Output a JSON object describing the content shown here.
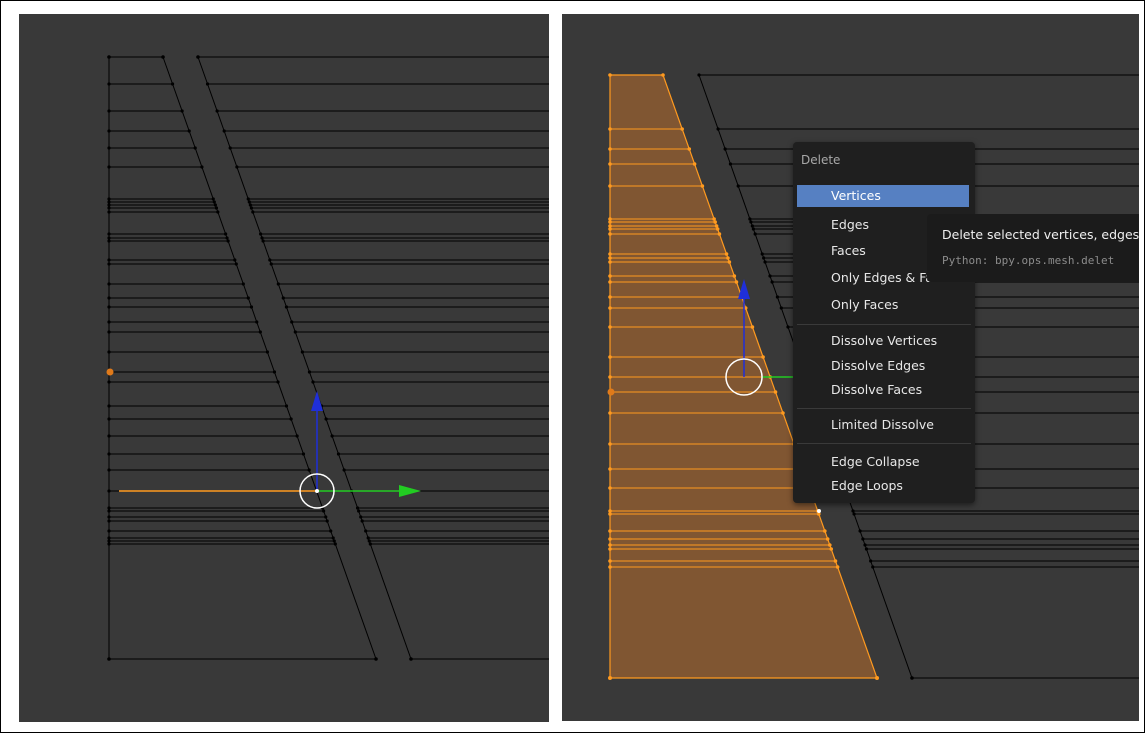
{
  "delete_menu": {
    "title": "Delete",
    "items": [
      {
        "label": "Vertices",
        "active": true
      },
      {
        "label": "Edges"
      },
      {
        "label": "Faces"
      },
      {
        "label": "Only Edges & Faces"
      },
      {
        "label": "Only Faces"
      },
      {
        "label": "Dissolve Vertices"
      },
      {
        "label": "Dissolve Edges"
      },
      {
        "label": "Dissolve Faces"
      },
      {
        "label": "Limited Dissolve"
      },
      {
        "label": "Edge Collapse"
      },
      {
        "label": "Edge Loops"
      }
    ]
  },
  "tooltip": {
    "title": "Delete selected vertices, edges",
    "python": "Python: bpy.ops.mesh.delet"
  },
  "colors": {
    "viewport_bg": "#393939",
    "wire": "#000000",
    "selected": "#ff9a1f",
    "selected_fill": "#8a5a26",
    "menu_bg": "#1f1f1f",
    "menu_highlight": "#5680c2",
    "axis_x": "#ff9a1f",
    "axis_y": "#2bd92b",
    "axis_z": "#1f2fd9",
    "gizmo_circle": "#ffffff"
  },
  "icons": [
    "move-gizmo-circle",
    "z-axis-arrow",
    "y-axis-arrow",
    "origin-dot"
  ]
}
